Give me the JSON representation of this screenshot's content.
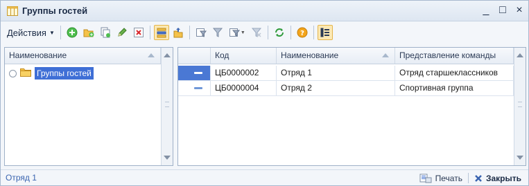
{
  "window": {
    "title": "Группы гостей",
    "minimize_glyph": "_",
    "maximize_glyph": "□",
    "close_glyph": "×"
  },
  "toolbar": {
    "actions_label": "Действия",
    "buttons": [
      "add-icon",
      "add-folder-icon",
      "copy-icon",
      "edit-icon",
      "delete-icon",
      "hierarchy-view-icon",
      "up-level-icon",
      "filter-by-value-icon",
      "set-filter-icon",
      "filter-dropdown-icon",
      "clear-filter-icon",
      "refresh-icon",
      "help-icon",
      "columns-icon"
    ]
  },
  "left_panel": {
    "header": "Наименование",
    "tree_item": "Группы гостей"
  },
  "table": {
    "columns": [
      "Код",
      "Наименование",
      "Представление команды"
    ],
    "rows": [
      {
        "code": "ЦБ0000002",
        "name": "Отряд 1",
        "team": "Отряд старшеклассников"
      },
      {
        "code": "ЦБ0000004",
        "name": "Отряд 2",
        "team": "Спортивная группа"
      }
    ]
  },
  "footer": {
    "status": "Отряд 1",
    "print_label": "Печать",
    "close_label": "Закрыть"
  },
  "colors": {
    "selection": "#4a78d4",
    "accent_active": "#fbe8b4",
    "status_text": "#3a64b0"
  }
}
